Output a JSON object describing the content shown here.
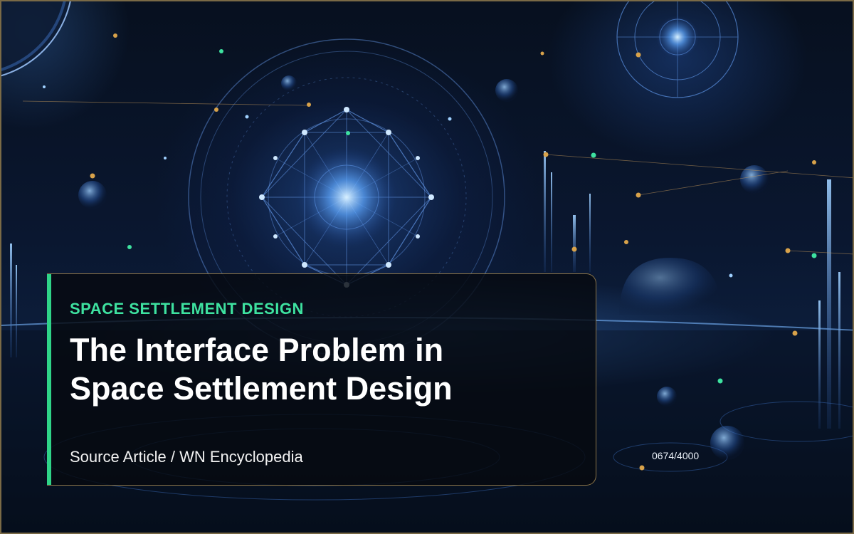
{
  "hero": {
    "background_description_icon": "cosmic-geometry-background",
    "accent_color": "#2fd488",
    "border_color": "#8a7448"
  },
  "card": {
    "kicker": "SPACE SETTLEMENT DESIGN",
    "title_line1": "The Interface Problem in",
    "title_line2": "Space Settlement Design",
    "source": "Source Article / WN Encyclopedia"
  },
  "counter": {
    "text": "0674/4000"
  }
}
